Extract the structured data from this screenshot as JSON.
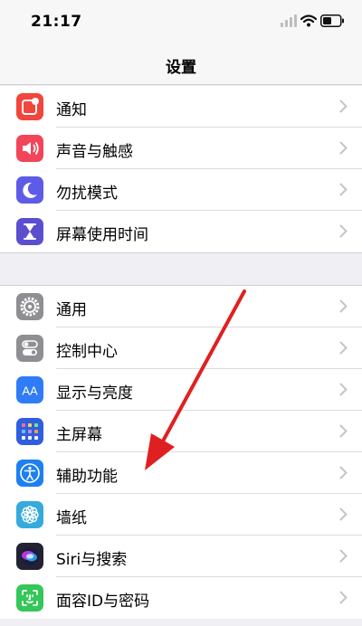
{
  "status_bar": {
    "time": "21:17",
    "icons": [
      "signal-icon",
      "wifi-icon",
      "battery-icon"
    ]
  },
  "nav": {
    "title": "设置"
  },
  "groups": [
    {
      "items": [
        {
          "label": "通知",
          "icon": "notifications-icon",
          "color": "#f2453d"
        },
        {
          "label": "声音与触感",
          "icon": "sounds-icon",
          "color": "#f2455a"
        },
        {
          "label": "勿扰模式",
          "icon": "moon-icon",
          "color": "#5e5ce6"
        },
        {
          "label": "屏幕使用时间",
          "icon": "hourglass-icon",
          "color": "#5b4fd0"
        }
      ]
    },
    {
      "items": [
        {
          "label": "通用",
          "icon": "gear-icon",
          "color": "#8e8e93"
        },
        {
          "label": "控制中心",
          "icon": "toggles-icon",
          "color": "#8e8e93"
        },
        {
          "label": "显示与亮度",
          "icon": "display-icon",
          "icon_text": "AA",
          "color": "#2f7cf6"
        },
        {
          "label": "主屏幕",
          "icon": "home-screen-icon",
          "color": "#2f5fe0"
        },
        {
          "label": "辅助功能",
          "icon": "accessibility-icon",
          "color": "#1e7ff0"
        },
        {
          "label": "墙纸",
          "icon": "wallpaper-icon",
          "color": "#35aadc"
        },
        {
          "label": "Siri与搜索",
          "icon": "siri-icon",
          "color": "#222233"
        },
        {
          "label": "面容ID与密码",
          "icon": "face-id-icon",
          "color": "#34c759"
        }
      ]
    }
  ],
  "annotation": {
    "type": "arrow",
    "color": "#e02020",
    "points_to": "辅助功能"
  }
}
